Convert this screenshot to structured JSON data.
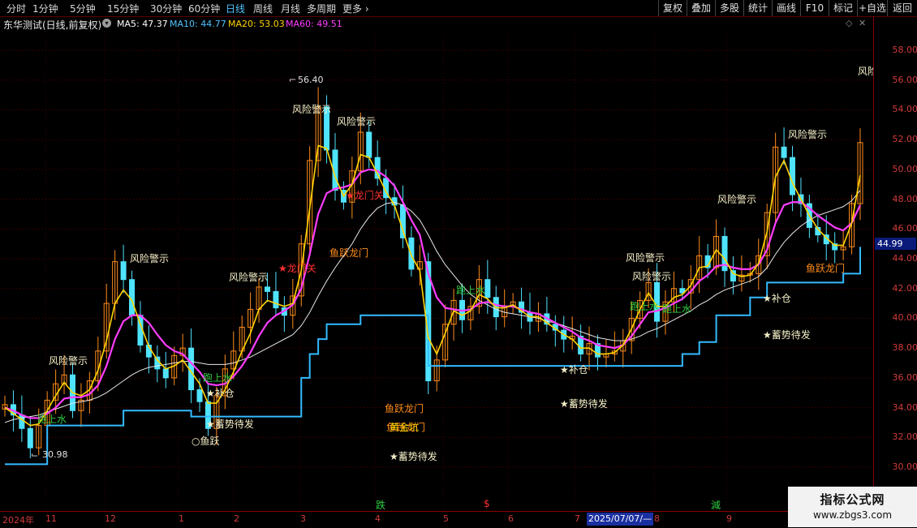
{
  "toolbar": {
    "periods": [
      "分时",
      "1分钟",
      "5分钟",
      "15分钟",
      "30分钟",
      "60分钟",
      "日线",
      "周线",
      "月线",
      "多周期",
      "更多"
    ],
    "active": "日线",
    "right_buttons": [
      "复权",
      "叠加",
      "多股",
      "统计",
      "画线",
      "F10",
      "标记",
      "+自选",
      "返回"
    ]
  },
  "info": {
    "stock_title": "东华测试(日线,前复权)",
    "ma5": "MA5: 47.37",
    "ma10": "MA10: 44.77",
    "ma20": "MA20: 53.03",
    "ma60": "MA60: 49.51",
    "colors": {
      "ma5": "#ffffff",
      "ma10": "#4fc3ff",
      "ma20": "#ffd400",
      "ma60": "#ff3dff"
    }
  },
  "price_axis": {
    "ticks": [
      "58.00",
      "56.00",
      "54.00",
      "52.00",
      "50.00",
      "48.00",
      "46.00",
      "44.00",
      "42.00",
      "40.00",
      "38.00",
      "36.00",
      "34.00",
      "32.00",
      "30.00"
    ],
    "current_price": "44.99"
  },
  "date_axis": {
    "labels": [
      "2024年",
      "11",
      "12",
      "1",
      "2",
      "3",
      "4",
      "5",
      "6",
      "7",
      "8",
      "9"
    ],
    "cursor_date": "2025/07/07/—",
    "flags": [
      {
        "text": "跌",
        "color": "#2ecc40"
      },
      {
        "text": "$",
        "color": "#ff3030"
      },
      {
        "text": "減",
        "color": "#2ecc40"
      }
    ]
  },
  "annotations": {
    "high_label": "56.40",
    "low_label": "30.98",
    "risk": "风险警示",
    "risk_edge": "风险",
    "jump": "鱼跃",
    "jump_dragon": "鱼跃龙门",
    "dragon_gate": "龙门关",
    "water": "跑上水",
    "add": "补仓",
    "waiting": "蓄势待发",
    "golden": "黄金坑"
  },
  "chart_data": {
    "type": "candlestick",
    "ylim": [
      29.5,
      59.0
    ],
    "price_series_close": [
      34.2,
      33.5,
      32.6,
      31.3,
      32.8,
      34.5,
      35.6,
      36.2,
      33.8,
      34.5,
      35.8,
      37.8,
      41.0,
      43.8,
      42.6,
      40.2,
      38.2,
      37.4,
      36.6,
      36.0,
      37.5,
      38.0,
      35.2,
      34.4,
      32.6,
      34.8,
      36.6,
      37.8,
      39.4,
      40.6,
      42.1,
      41.8,
      40.7,
      40.2,
      41.5,
      45.0,
      50.6,
      54.2,
      51.3,
      48.6,
      47.8,
      49.9,
      52.5,
      50.8,
      49.4,
      48.1,
      47.6,
      45.4,
      43.3,
      43.8,
      35.8,
      37.2,
      39.6,
      41.2,
      39.9,
      40.8,
      42.6,
      41.4,
      40.1,
      40.8,
      41.1,
      40.4,
      39.8,
      40.3,
      39.6,
      39.2,
      38.6,
      38.8,
      37.6,
      38.3,
      37.4,
      37.6,
      37.8,
      38.5,
      40.0,
      41.2,
      42.4,
      39.8,
      41.1,
      42.0,
      41.7,
      42.6,
      44.2,
      43.4,
      45.5,
      43.2,
      42.5,
      42.9,
      43.0,
      44.2,
      47.1,
      51.5,
      50.8,
      48.3,
      47.7,
      46.1,
      45.6,
      45.0,
      44.6,
      44.8,
      47.7,
      51.8
    ],
    "ma5": [
      34.0,
      33.6,
      33.2,
      32.8,
      32.9,
      33.8,
      34.8,
      35.7,
      35.0,
      34.8,
      35.2,
      36.5,
      38.5,
      41.0,
      41.9,
      41.2,
      39.6,
      38.1,
      37.2,
      36.6,
      36.8,
      37.2,
      36.4,
      35.6,
      34.3,
      34.3,
      35.2,
      36.4,
      37.8,
      39.0,
      40.6,
      41.2,
      41.0,
      40.8,
      41.0,
      43.2,
      47.4,
      51.6,
      51.4,
      49.5,
      48.2,
      49.0,
      51.0,
      50.8,
      49.7,
      48.5,
      47.6,
      45.9,
      44.2,
      43.2,
      38.7,
      37.6,
      39.0,
      40.5,
      40.2,
      40.5,
      41.6,
      41.3,
      40.7,
      40.7,
      40.9,
      40.5,
      40.1,
      40.1,
      39.7,
      39.3,
      38.9,
      38.6,
      38.0,
      38.0,
      37.6,
      37.6,
      37.7,
      38.2,
      39.3,
      40.6,
      41.7,
      40.8,
      40.8,
      41.4,
      41.6,
      42.2,
      43.4,
      43.5,
      44.6,
      44.0,
      43.0,
      42.8,
      42.9,
      43.7,
      45.8,
      49.5,
      50.6,
      49.1,
      48.0,
      46.9,
      46.0,
      45.4,
      44.9,
      44.9,
      46.4,
      49.6
    ],
    "ma20": [
      34.0,
      33.8,
      33.5,
      33.3,
      33.3,
      33.6,
      34.0,
      34.6,
      34.7,
      34.7,
      34.9,
      35.5,
      36.8,
      38.6,
      39.8,
      40.2,
      40.2,
      39.7,
      38.9,
      38.2,
      37.8,
      37.6,
      37.0,
      36.4,
      35.6,
      35.5,
      35.6,
      36.1,
      36.8,
      37.7,
      38.8,
      39.7,
      40.2,
      40.5,
      40.9,
      42.0,
      44.3,
      47.0,
      48.4,
      48.7,
      48.8,
      49.0,
      49.8,
      50.0,
      49.9,
      49.5,
      48.9,
      47.8,
      46.6,
      45.6,
      43.0,
      41.4,
      40.7,
      40.6,
      40.5,
      40.6,
      41.0,
      41.1,
      40.9,
      40.8,
      40.8,
      40.6,
      40.4,
      40.3,
      40.0,
      39.7,
      39.4,
      39.1,
      38.7,
      38.5,
      38.2,
      38.1,
      38.0,
      38.2,
      38.8,
      39.6,
      40.4,
      40.5,
      40.7,
      41.0,
      41.3,
      41.8,
      42.5,
      42.9,
      43.5,
      43.6,
      43.4,
      43.3,
      43.3,
      43.6,
      44.6,
      46.4,
      47.6,
      47.8,
      47.8,
      47.4,
      46.9,
      46.5,
      46.1,
      45.9,
      46.4,
      47.6
    ],
    "ma60": [
      33.0,
      33.2,
      33.3,
      33.4,
      33.5,
      33.7,
      33.9,
      34.1,
      34.3,
      34.4,
      34.5,
      34.7,
      35.0,
      35.4,
      35.8,
      36.2,
      36.5,
      36.7,
      36.8,
      36.9,
      37.0,
      37.1,
      37.1,
      37.0,
      36.9,
      36.9,
      36.9,
      37.0,
      37.2,
      37.4,
      37.7,
      38.0,
      38.3,
      38.6,
      38.9,
      39.5,
      40.4,
      41.5,
      42.5,
      43.4,
      44.2,
      45.0,
      46.0,
      46.8,
      47.4,
      47.7,
      47.8,
      47.6,
      47.2,
      46.6,
      45.6,
      44.5,
      43.6,
      42.9,
      42.2,
      41.6,
      41.2,
      40.9,
      40.6,
      40.4,
      40.3,
      40.2,
      40.1,
      40.0,
      39.8,
      39.7,
      39.5,
      39.3,
      39.1,
      38.9,
      38.7,
      38.6,
      38.5,
      38.5,
      38.6,
      38.8,
      39.1,
      39.3,
      39.6,
      39.9,
      40.2,
      40.5,
      40.9,
      41.2,
      41.6,
      41.9,
      42.1,
      42.3,
      42.5,
      42.8,
      43.4,
      44.3,
      45.1,
      45.7,
      46.2,
      46.6,
      46.9,
      47.1,
      47.3,
      47.5,
      47.9,
      48.6
    ],
    "stop_line": [
      30.2,
      30.2,
      30.2,
      30.2,
      30.2,
      32.8,
      32.8,
      32.8,
      32.8,
      32.8,
      32.8,
      32.8,
      32.8,
      32.8,
      33.8,
      33.8,
      33.8,
      33.8,
      33.8,
      33.8,
      33.8,
      33.8,
      33.4,
      33.4,
      33.4,
      33.4,
      33.4,
      33.4,
      33.4,
      33.4,
      33.4,
      33.4,
      33.4,
      33.4,
      33.4,
      36.0,
      37.6,
      38.6,
      39.6,
      39.6,
      39.6,
      39.6,
      40.2,
      40.2,
      40.2,
      40.2,
      40.2,
      40.2,
      40.2,
      40.2,
      36.8,
      36.8,
      36.8,
      36.8,
      36.8,
      36.8,
      36.8,
      36.8,
      36.8,
      36.8,
      36.8,
      36.8,
      36.8,
      36.8,
      36.8,
      36.8,
      36.8,
      36.8,
      36.8,
      36.8,
      36.8,
      36.8,
      36.8,
      36.8,
      36.8,
      36.8,
      36.8,
      36.8,
      36.8,
      36.8,
      37.6,
      37.6,
      38.4,
      38.4,
      40.2,
      40.2,
      40.2,
      40.2,
      41.4,
      41.4,
      42.4,
      42.4,
      42.4,
      42.4,
      42.4,
      42.4,
      42.4,
      42.4,
      42.4,
      43.0,
      43.0,
      44.8
    ]
  }
}
